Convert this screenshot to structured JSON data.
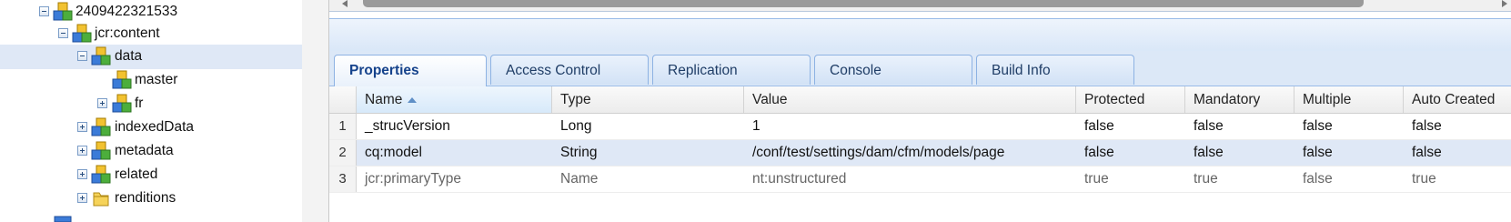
{
  "tree": {
    "nodes": [
      {
        "label": "2409422321533",
        "toggle": "minus",
        "icon": "node-cube-icon",
        "depth": 0
      },
      {
        "label": "jcr:content",
        "toggle": "minus",
        "icon": "node-cube-icon",
        "depth": 1
      },
      {
        "label": "data",
        "toggle": "minus",
        "icon": "node-cube-icon",
        "depth": 2,
        "selected": true
      },
      {
        "label": "master",
        "toggle": "none",
        "icon": "node-cube-icon",
        "depth": 3
      },
      {
        "label": "fr",
        "toggle": "plus",
        "icon": "node-cube-icon",
        "depth": 3
      },
      {
        "label": "indexedData",
        "toggle": "plus",
        "icon": "node-cube-icon",
        "depth": 2
      },
      {
        "label": "metadata",
        "toggle": "plus",
        "icon": "node-cube-icon",
        "depth": 2
      },
      {
        "label": "related",
        "toggle": "plus",
        "icon": "node-cube-icon",
        "depth": 2
      },
      {
        "label": "renditions",
        "toggle": "plus",
        "icon": "folder-icon",
        "depth": 2
      }
    ]
  },
  "tabs": [
    {
      "label": "Properties",
      "active": true
    },
    {
      "label": "Access Control"
    },
    {
      "label": "Replication"
    },
    {
      "label": "Console"
    },
    {
      "label": "Build Info"
    }
  ],
  "grid": {
    "columns": [
      "Name",
      "Type",
      "Value",
      "Protected",
      "Mandatory",
      "Multiple",
      "Auto Created"
    ],
    "sorted_column": "Name",
    "rows": [
      {
        "num": "1",
        "cells": [
          "_strucVersion",
          "Long",
          "1",
          "false",
          "false",
          "false",
          "false"
        ]
      },
      {
        "num": "2",
        "cells": [
          "cq:model",
          "String",
          "/conf/test/settings/dam/cfm/models/page",
          "false",
          "false",
          "false",
          "false"
        ],
        "selected": true
      },
      {
        "num": "3",
        "cells": [
          "jcr:primaryType",
          "Name",
          "nt:unstructured",
          "true",
          "true",
          "false",
          "true"
        ],
        "dim": true
      }
    ]
  },
  "colors": {
    "selection": "#dfe8f6",
    "tab_text": "#15428b",
    "tab_border": "#99bbe8"
  }
}
